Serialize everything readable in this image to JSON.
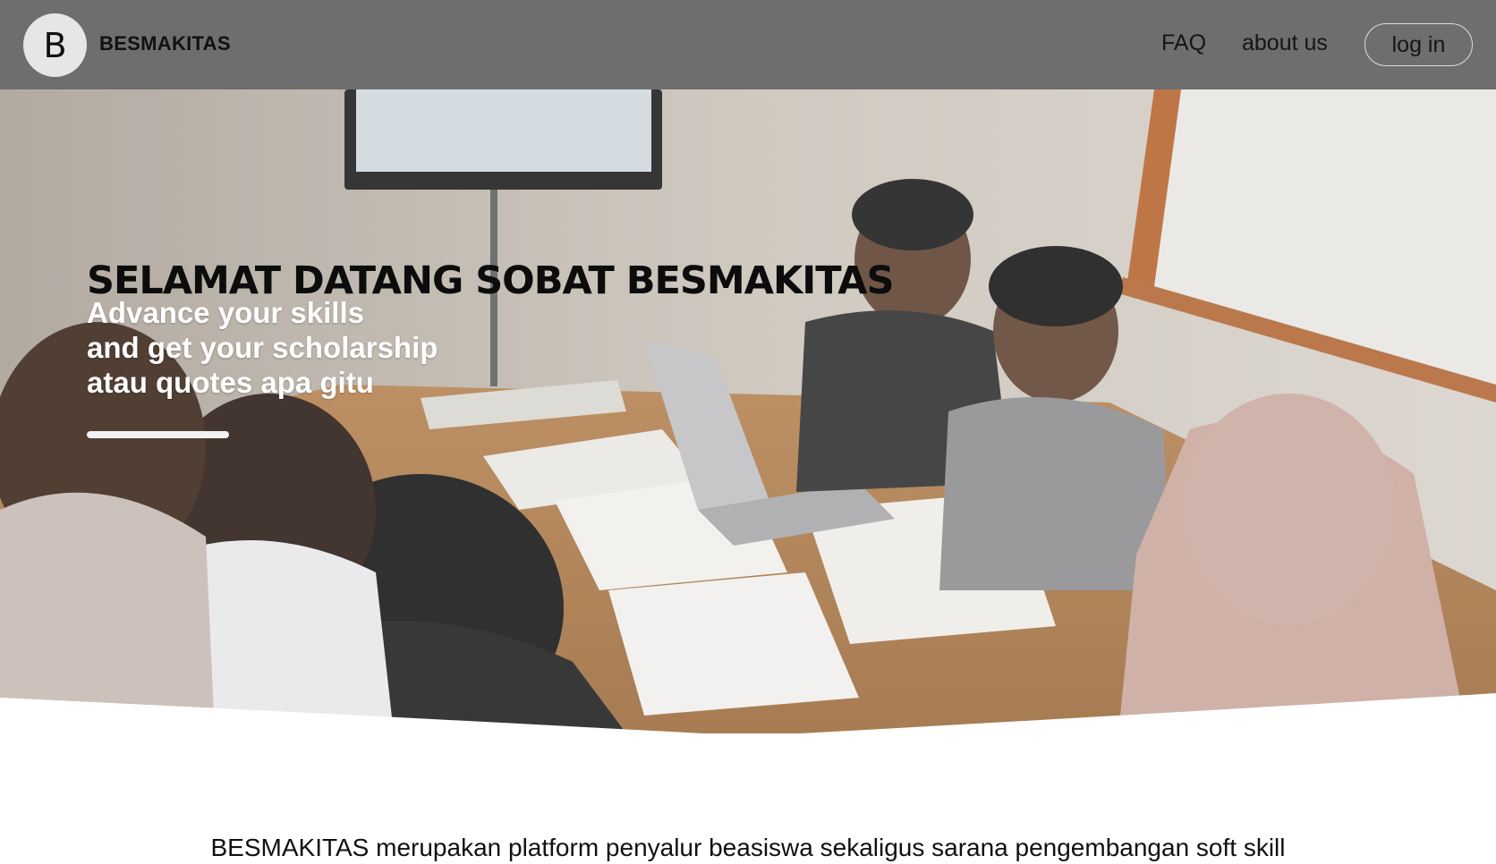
{
  "navbar": {
    "logo_letter": "B",
    "brand": "BESMAKITAS",
    "faq_label": "FAQ",
    "about_label": "about us",
    "login_label": "log in"
  },
  "hero": {
    "title": "SELAMAT DATANG SOBAT BESMAKITAS",
    "subtitle_lines": [
      "Advance your skills",
      "and get your scholarship",
      "atau quotes apa gitu"
    ],
    "image_description": "photo of students studying around a table"
  },
  "description": {
    "text": "BESMAKITAS merupakan platform penyalur beasiswa sekaligus sarana pengembangan soft skill"
  },
  "colors": {
    "navbar_bg": "#6e6e6e",
    "logo_bg": "#e6e6e6",
    "title_text": "#0c0c0c",
    "subtitle_text": "#ffffff"
  }
}
